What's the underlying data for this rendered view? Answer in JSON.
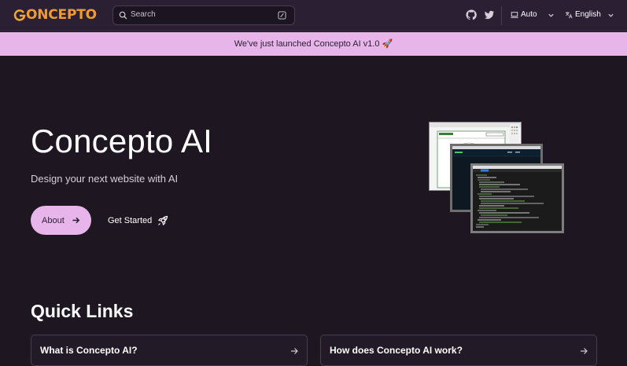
{
  "navbar": {
    "logo": "ONCEPTO",
    "logo_letter": "G",
    "search_placeholder": "Search",
    "theme_label": "Auto",
    "language_label": "English"
  },
  "banner": {
    "text": "We've just launched Concepto AI v1.0 🚀"
  },
  "hero": {
    "title": "Concepto AI",
    "subtitle": "Design your next website with AI",
    "about_label": "About",
    "start_label": "Get Started"
  },
  "quick_links": {
    "title": "Quick Links",
    "cards": [
      {
        "label": "What is Concepto AI?"
      },
      {
        "label": "How does Concepto AI work?"
      }
    ]
  },
  "colors": {
    "background": "#1e1621",
    "navbar": "#2b1f34",
    "accent": "#e7b5ea",
    "logo": "#f29a2e"
  },
  "icons": [
    "search-icon",
    "keyboard-shortcut-icon",
    "github-icon",
    "twitter-icon",
    "monitor-icon",
    "translate-icon",
    "chevron-down-icon",
    "arrow-right-icon",
    "rocket-icon"
  ]
}
